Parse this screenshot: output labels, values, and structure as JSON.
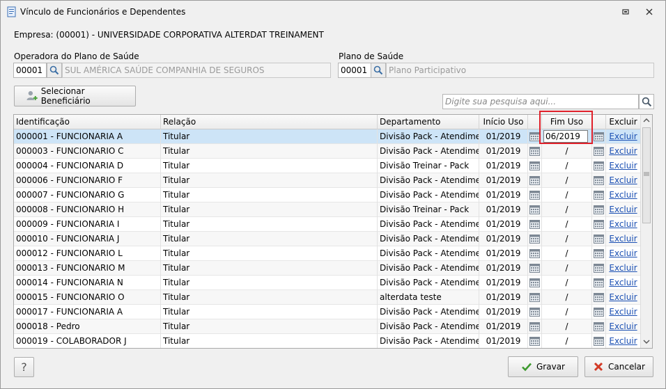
{
  "window": {
    "title": "Vínculo de Funcionários e Dependentes"
  },
  "empresa": {
    "text": "Empresa: (00001) - UNIVERSIDADE CORPORATIVA ALTERDAT TREINAMENT"
  },
  "operadora": {
    "label": "Operadora do Plano de Saúde",
    "code": "00001",
    "name": "SUL AMÉRICA SAÚDE COMPANHIA DE SEGUROS"
  },
  "plano": {
    "label": "Plano de Saúde",
    "code": "00001",
    "name": "Plano Participativo"
  },
  "toolbar": {
    "select_beneficiary": "Selecionar Beneficiário",
    "search_placeholder": "Digite sua pesquisa aqui..."
  },
  "grid": {
    "headers": {
      "id": "Identificação",
      "relation": "Relação",
      "department": "Departamento",
      "start": "Início Uso",
      "end": "Fim Uso",
      "delete": "Excluir"
    },
    "editing_value": "06/2019",
    "rows": [
      {
        "id": "000001 - FUNCIONARIA A",
        "relation": "Titular",
        "department": "Divisão Pack - Atendiment",
        "start": "01/2019",
        "end": "",
        "delete": "Excluir"
      },
      {
        "id": "000003 - FUNCIONARIO C",
        "relation": "Titular",
        "department": "Divisão Pack - Atendiment",
        "start": "01/2019",
        "end": "/",
        "delete": "Excluir"
      },
      {
        "id": "000004 - FUNCIONARIA D",
        "relation": "Titular",
        "department": "Divisão Treinar - Pack",
        "start": "01/2019",
        "end": "/",
        "delete": "Excluir"
      },
      {
        "id": "000006 - FUNCIONARIO F",
        "relation": "Titular",
        "department": "Divisão Pack - Atendiment",
        "start": "01/2019",
        "end": "/",
        "delete": "Excluir"
      },
      {
        "id": "000007 - FUNCIONARIO G",
        "relation": "Titular",
        "department": "Divisão Pack - Atendiment",
        "start": "01/2019",
        "end": "/",
        "delete": "Excluir"
      },
      {
        "id": "000008 - FUNCIONARIO H",
        "relation": "Titular",
        "department": "Divisão Treinar - Pack",
        "start": "01/2019",
        "end": "/",
        "delete": "Excluir"
      },
      {
        "id": "000009 - FUNCIONARIA I",
        "relation": "Titular",
        "department": "Divisão Pack - Atendiment",
        "start": "01/2019",
        "end": "/",
        "delete": "Excluir"
      },
      {
        "id": "000010 - FUNCIONARIA J",
        "relation": "Titular",
        "department": "Divisão Pack - Atendiment",
        "start": "01/2019",
        "end": "/",
        "delete": "Excluir"
      },
      {
        "id": "000012 - FUNCIONARIO L",
        "relation": "Titular",
        "department": "Divisão Pack - Atendiment",
        "start": "01/2019",
        "end": "/",
        "delete": "Excluir"
      },
      {
        "id": "000013 - FUNCIONARIO M",
        "relation": "Titular",
        "department": "Divisão Pack - Atendiment",
        "start": "01/2019",
        "end": "/",
        "delete": "Excluir"
      },
      {
        "id": "000014 - FUNCIONARIA N",
        "relation": "Titular",
        "department": "Divisão Pack - Atendiment",
        "start": "01/2019",
        "end": "/",
        "delete": "Excluir"
      },
      {
        "id": "000015 - FUNCIONARIO O",
        "relation": "Titular",
        "department": "alterdata teste",
        "start": "01/2019",
        "end": "/",
        "delete": "Excluir"
      },
      {
        "id": "000017 - FUNCIONARIA A",
        "relation": "Titular",
        "department": "Divisão Pack - Atendiment",
        "start": "01/2019",
        "end": "/",
        "delete": "Excluir"
      },
      {
        "id": "000018 - Pedro",
        "relation": "Titular",
        "department": "Divisão Pack - Atendiment",
        "start": "01/2019",
        "end": "/",
        "delete": "Excluir"
      },
      {
        "id": "000019 - COLABORADOR J",
        "relation": "Titular",
        "department": "Divisão Pack - Atendiment",
        "start": "01/2019",
        "end": "/",
        "delete": "Excluir"
      }
    ]
  },
  "footer": {
    "help": "?",
    "save": "Gravar",
    "cancel": "Cancelar"
  },
  "colors": {
    "selected_row": "#cde4f7",
    "link": "#1a4fb3",
    "highlight": "#e0202a"
  }
}
